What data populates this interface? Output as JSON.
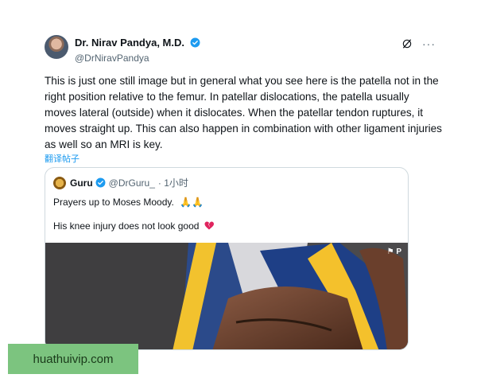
{
  "tweet": {
    "author_name": "Dr. Nirav Pandya, M.D.",
    "author_handle": "@DrNiravPandya",
    "body": "This is just one still image but in general what you see here is the patella not in the right position relative to the femur. In patellar dislocations, the patella usually moves lateral (outside) when it dislocates.  When the patellar tendon ruptures, it moves straight up.  This can also happen in combination with other ligament injuries as well so an MRI is key.",
    "translate_label": "翻译帖子",
    "more_label": "···"
  },
  "quote": {
    "author_name": "Guru",
    "author_handle": "@DrGuru_",
    "time": "· 1小时",
    "line1": "Prayers up to Moses Moody.",
    "line1_emoji": "🙏🙏",
    "line2": "His knee injury does not look good",
    "media_badge": "⚑ P"
  },
  "watermark": {
    "text": "huathuivip.com"
  },
  "colors": {
    "accent": "#1d9bf0",
    "text": "#0f1419",
    "muted": "#536471",
    "border": "#cfd9de",
    "watermark_bg": "#7cc47f"
  },
  "icons": [
    "verified-badge-icon",
    "grok-icon",
    "more-icon",
    "broken-heart-icon"
  ]
}
